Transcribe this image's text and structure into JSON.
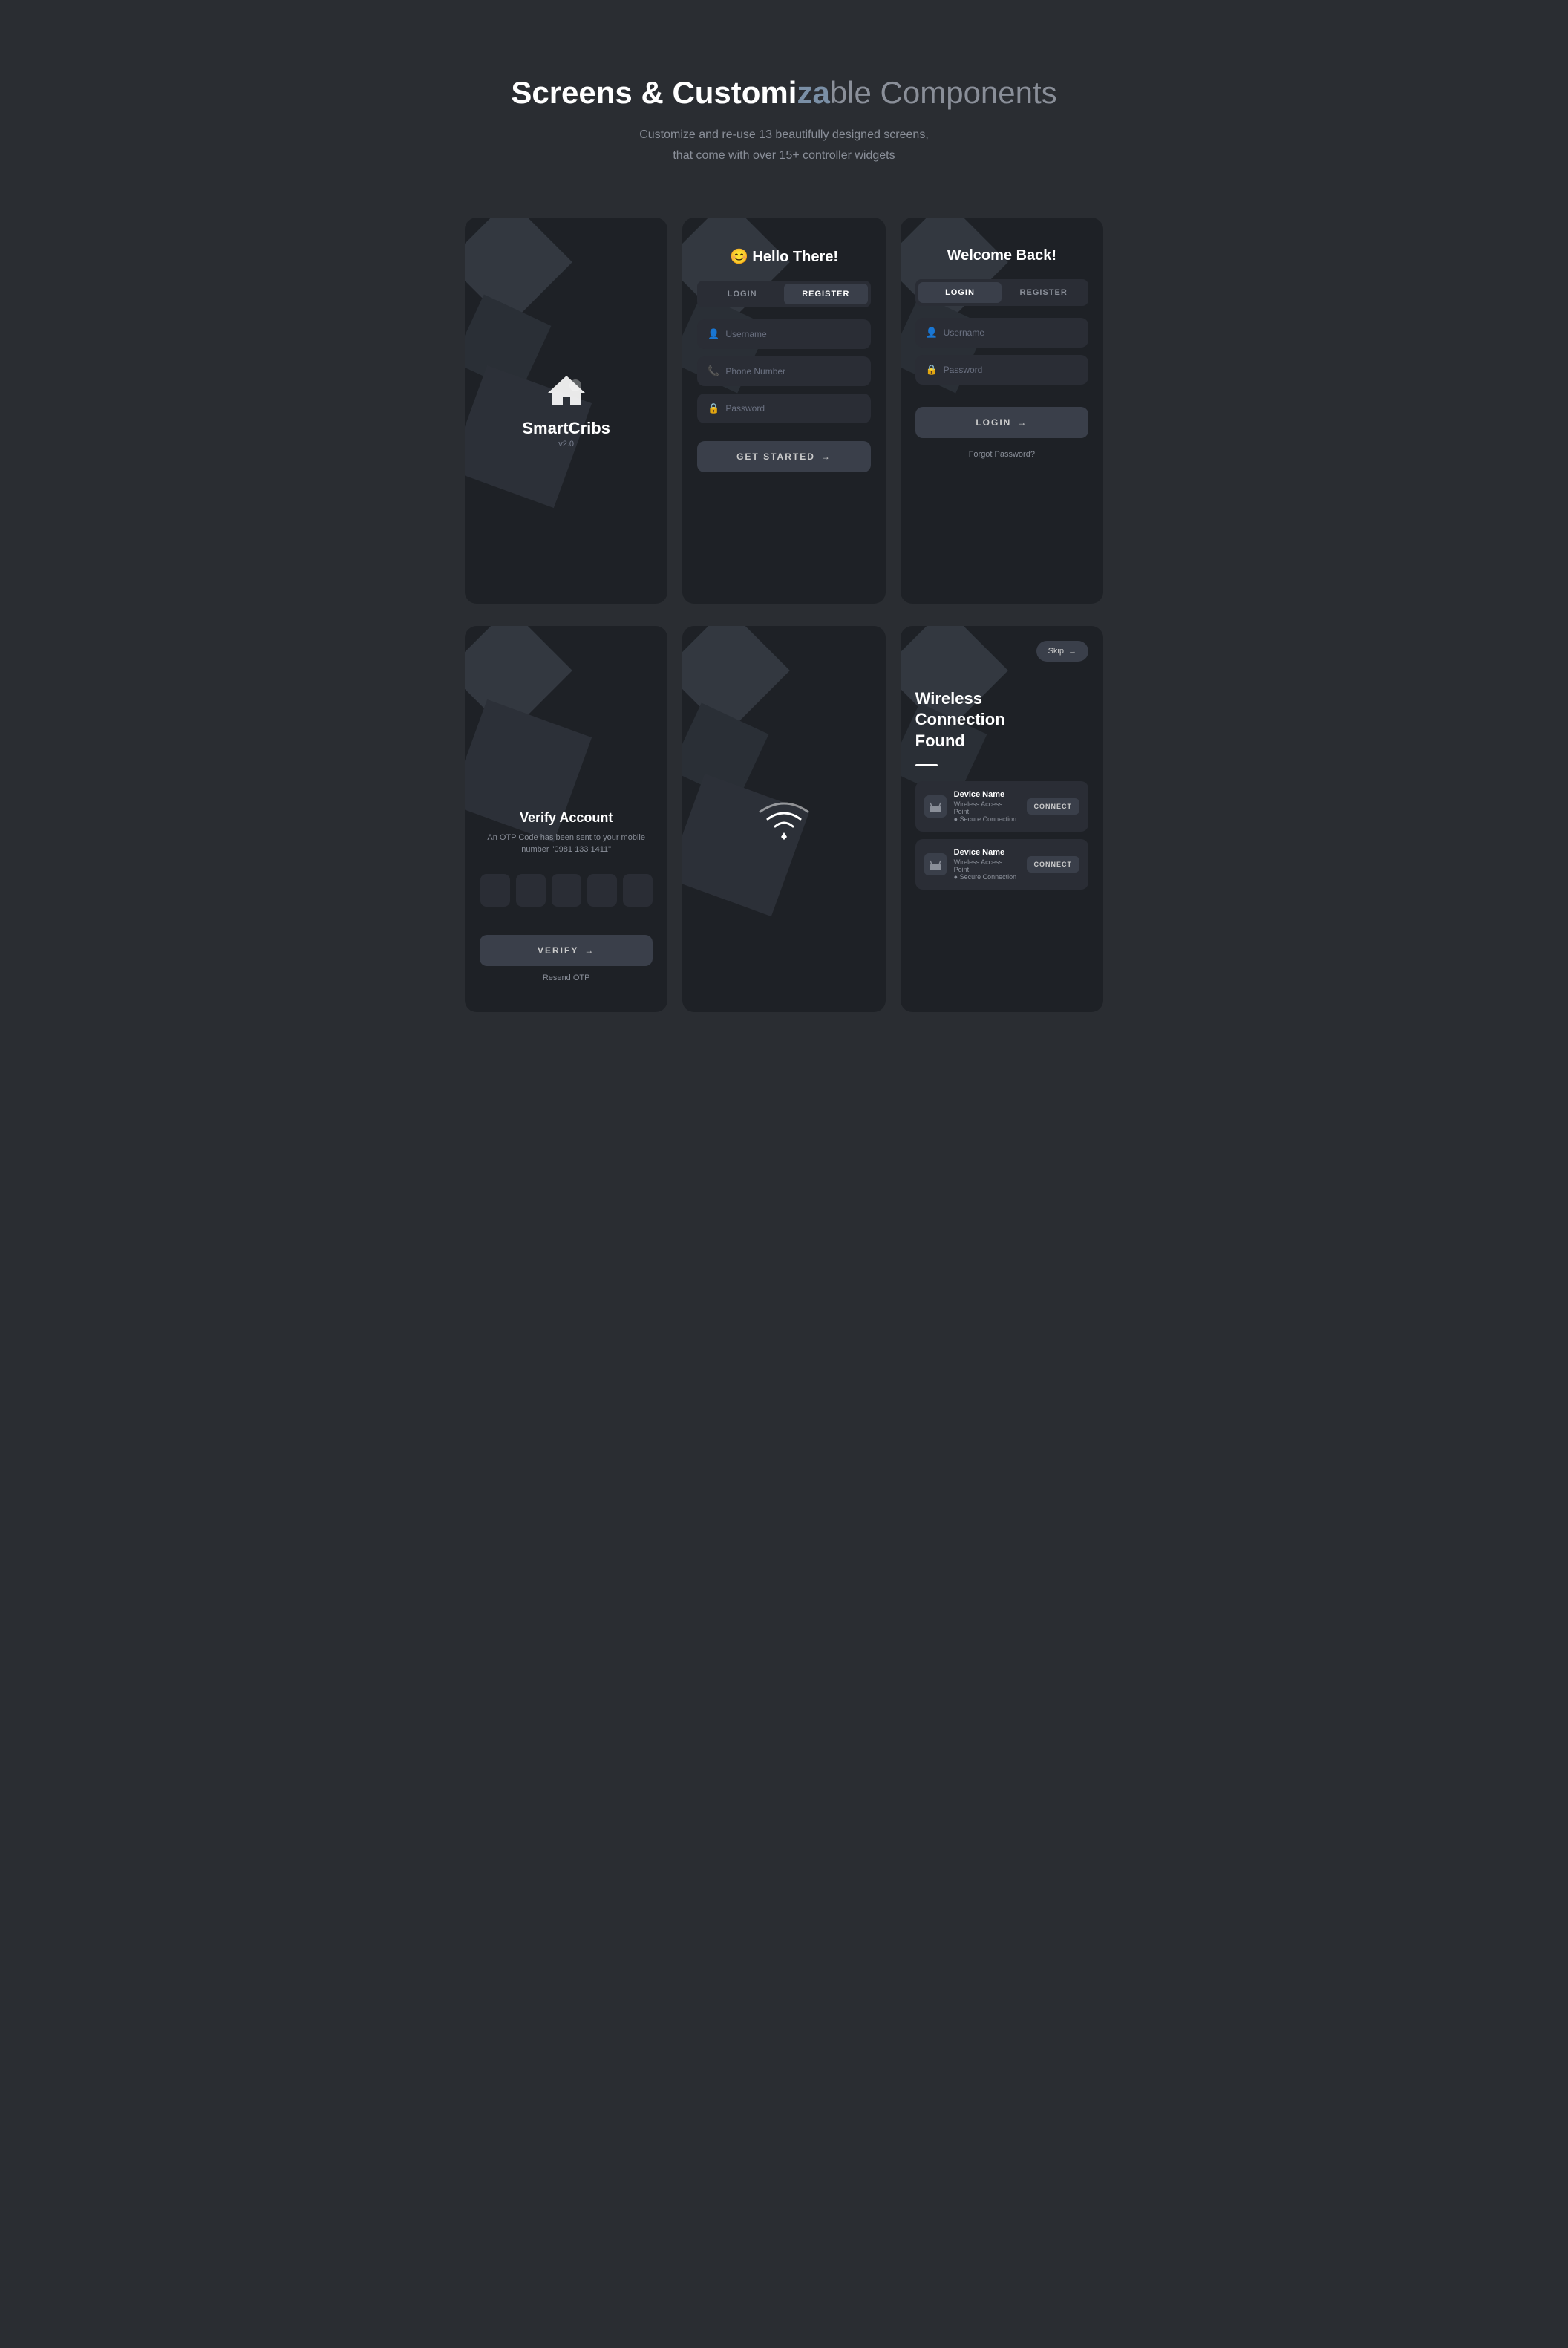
{
  "header": {
    "title_part1": "Screens & Customi",
    "title_highlight": "za",
    "title_part2": "ble Components",
    "subtitle_line1": "Customize and re-use 13 beautifully designed screens,",
    "subtitle_line2": "that come with over 15+ controller widgets"
  },
  "card1": {
    "logo_text": "SmartCribs",
    "version": "v2.0"
  },
  "card2": {
    "greeting": "😊 Hello There!",
    "tab_login": "LOGIN",
    "tab_register": "REGISTER",
    "field_username": "Username",
    "field_phone": "Phone Number",
    "field_password": "Password",
    "button_label": "GET STARTED",
    "button_arrow": "→"
  },
  "card3": {
    "welcome": "Welcome Back!",
    "tab_login": "LOGIN",
    "tab_register": "REGISTER",
    "field_username": "Username",
    "field_password": "Password",
    "button_label": "LOGIN",
    "button_arrow": "→",
    "forgot_password": "Forgot Password?"
  },
  "card4": {
    "title": "Verify Account",
    "subtitle": "An OTP Code has been sent to your mobile",
    "subtitle2": "number \"0981 133 1411\"",
    "button_label": "VERIFY",
    "button_arrow": "→",
    "resend": "Resend OTP"
  },
  "card5": {
    "wifi_label": "wifi"
  },
  "card6": {
    "skip_label": "Skip",
    "skip_arrow": "→",
    "title_line1": "Wireless",
    "title_line2": "Connection",
    "title_line3": "Found",
    "device1_name": "Device Name",
    "device1_type": "Wireless Access Point",
    "device1_secure": "● Secure Connection",
    "device1_connect": "CONNECT",
    "device2_name": "Device Name",
    "device2_type": "Wireless Access Point",
    "device2_secure": "● Secure Connection",
    "device2_connect": "CONNECT"
  }
}
